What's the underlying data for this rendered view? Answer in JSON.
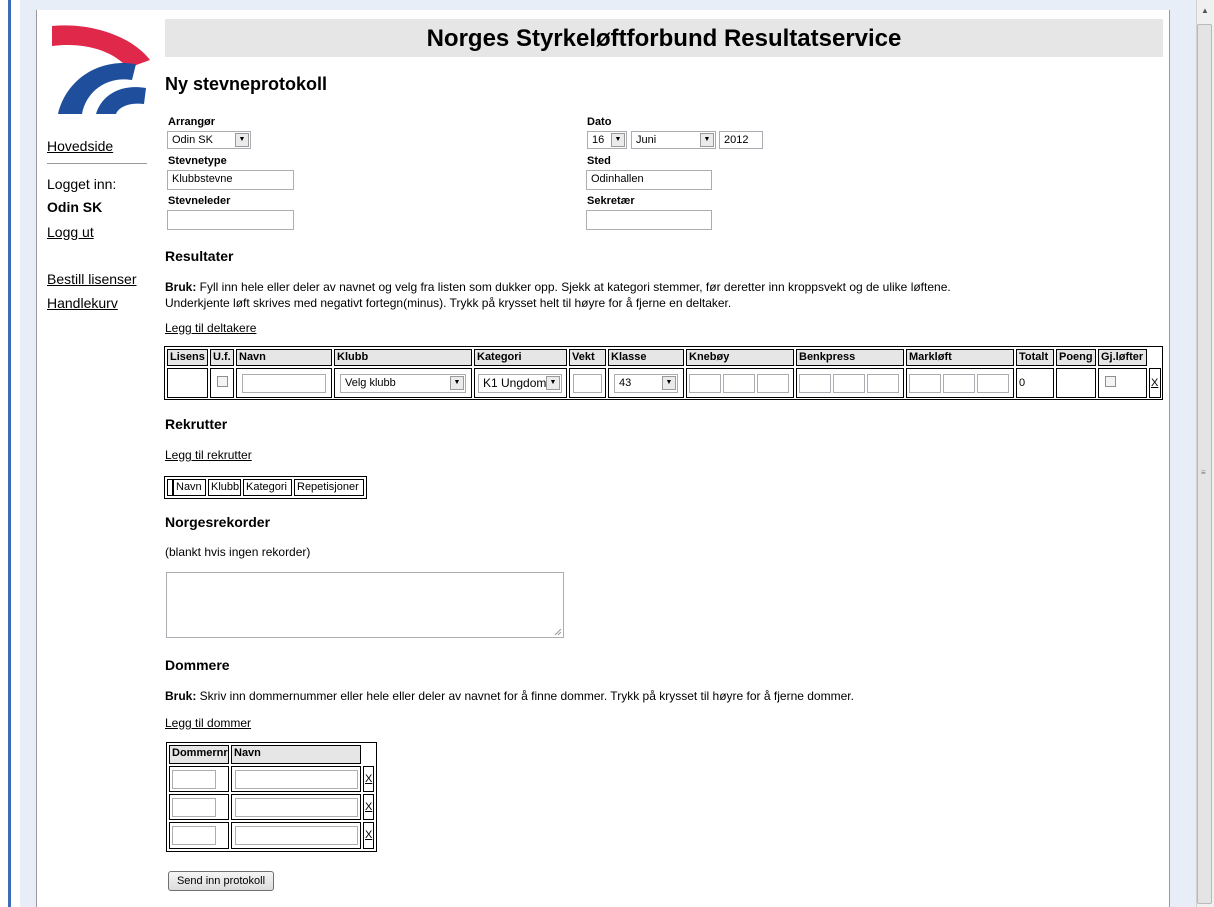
{
  "site_title": "Norges Styrkeløftforbund Resultatservice",
  "page_title": "Ny stevneprotokoll",
  "nav": {
    "home": "Hovedside",
    "logged_in_label": "Logget inn:",
    "user": "Odin SK",
    "logout": "Logg ut",
    "order_licenses": "Bestill lisenser",
    "cart": "Handlekurv"
  },
  "form": {
    "organizer_label": "Arrangør",
    "organizer_value": "Odin SK",
    "date_label": "Dato",
    "date_day": "16",
    "date_month": "Juni",
    "date_year": "2012",
    "type_label": "Stevnetype",
    "type_value": "Klubbstevne",
    "place_label": "Sted",
    "place_value": "Odinhallen",
    "leader_label": "Stevneleder",
    "leader_value": "",
    "secretary_label": "Sekretær",
    "secretary_value": ""
  },
  "results": {
    "heading": "Resultater",
    "usage_bold": "Bruk:",
    "usage_line1": " Fyll inn hele eller deler av navnet og velg fra listen som dukker opp. Sjekk at kategori stemmer, før deretter inn kroppsvekt og de ulike løftene.",
    "usage_line2": "Underkjente løft skrives med negativt fortegn(minus). Trykk på krysset helt til høyre for å fjerne en deltaker.",
    "add_link": "Legg til deltakere",
    "columns": [
      "Lisens",
      "U.f.",
      "Navn",
      "Klubb",
      "Kategori",
      "Vekt",
      "Klasse",
      "Knebøy",
      "Benkpress",
      "Markløft",
      "Totalt",
      "Poeng",
      "Gj.løfter"
    ],
    "row": {
      "club": "Velg klubb",
      "category": "K1 Ungdom",
      "class": "43",
      "total": "0",
      "remove": "X"
    }
  },
  "recruits": {
    "heading": "Rekrutter",
    "add_link": "Legg til rekrutter",
    "columns": [
      "Navn",
      "Klubb",
      "Kategori",
      "Repetisjoner"
    ]
  },
  "records": {
    "heading": "Norgesrekorder",
    "hint": "(blankt hvis ingen rekorder)"
  },
  "judges": {
    "heading": "Dommere",
    "usage_bold": "Bruk:",
    "usage": " Skriv inn dommernummer eller hele eller deler av navnet for å finne dommer. Trykk på krysset til høyre for å fjerne dommer.",
    "add_link": "Legg til dommer",
    "columns": [
      "Dommernr",
      "Navn"
    ],
    "remove": "X"
  },
  "submit": "Send inn protokoll",
  "colors": {
    "logo_red": "#e0284a",
    "logo_blue": "#1f4f9c",
    "header_bg": "#e6e6e6"
  }
}
